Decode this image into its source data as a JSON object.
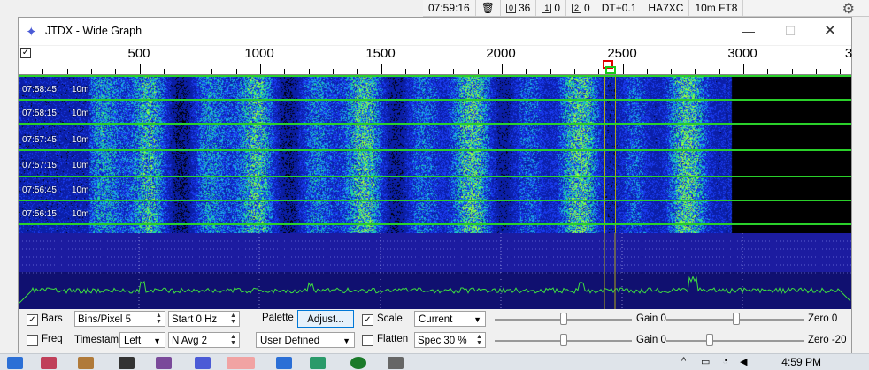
{
  "statusbar": {
    "time": "07:59:16",
    "count_36": "36",
    "box1": "1",
    "count_1": "0",
    "box2": "2",
    "count_2": "0",
    "dt": "DT+0.1",
    "callsign": "HA7XC",
    "mode": "10m FT8"
  },
  "window": {
    "title": "JTDX - Wide Graph"
  },
  "ruler": {
    "ticks": [
      "500",
      "1000",
      "1500",
      "2000",
      "2500",
      "3000"
    ]
  },
  "waterfall": {
    "rows": [
      {
        "time": "07:58:45",
        "band": "10m"
      },
      {
        "time": "07:58:15",
        "band": "10m"
      },
      {
        "time": "07:57:45",
        "band": "10m"
      },
      {
        "time": "07:57:15",
        "band": "10m"
      },
      {
        "time": "07:56:45",
        "band": "10m"
      },
      {
        "time": "07:56:15",
        "band": "10m"
      }
    ]
  },
  "controls": {
    "bars_label": "Bars",
    "freq_label": "Freq",
    "bins_value": "Bins/Pixel  5",
    "start_value": "Start 0 Hz",
    "timestamp_label": "Timestamp",
    "timestamp_value": "Left",
    "navg_value": "N Avg 2",
    "palette_label": "Palette",
    "adjust_button": "Adjust...",
    "palette_value": "User Defined",
    "scale_label": "Scale",
    "flatten_label": "Flatten",
    "current_value": "Current",
    "spec_value": "Spec 30 %",
    "gain1_label": "Gain 0",
    "zero1_label": "Zero 0",
    "gain2_label": "Gain 0",
    "zero2_label": "Zero -20"
  },
  "taskbar": {
    "clock": "4:59 PM"
  }
}
